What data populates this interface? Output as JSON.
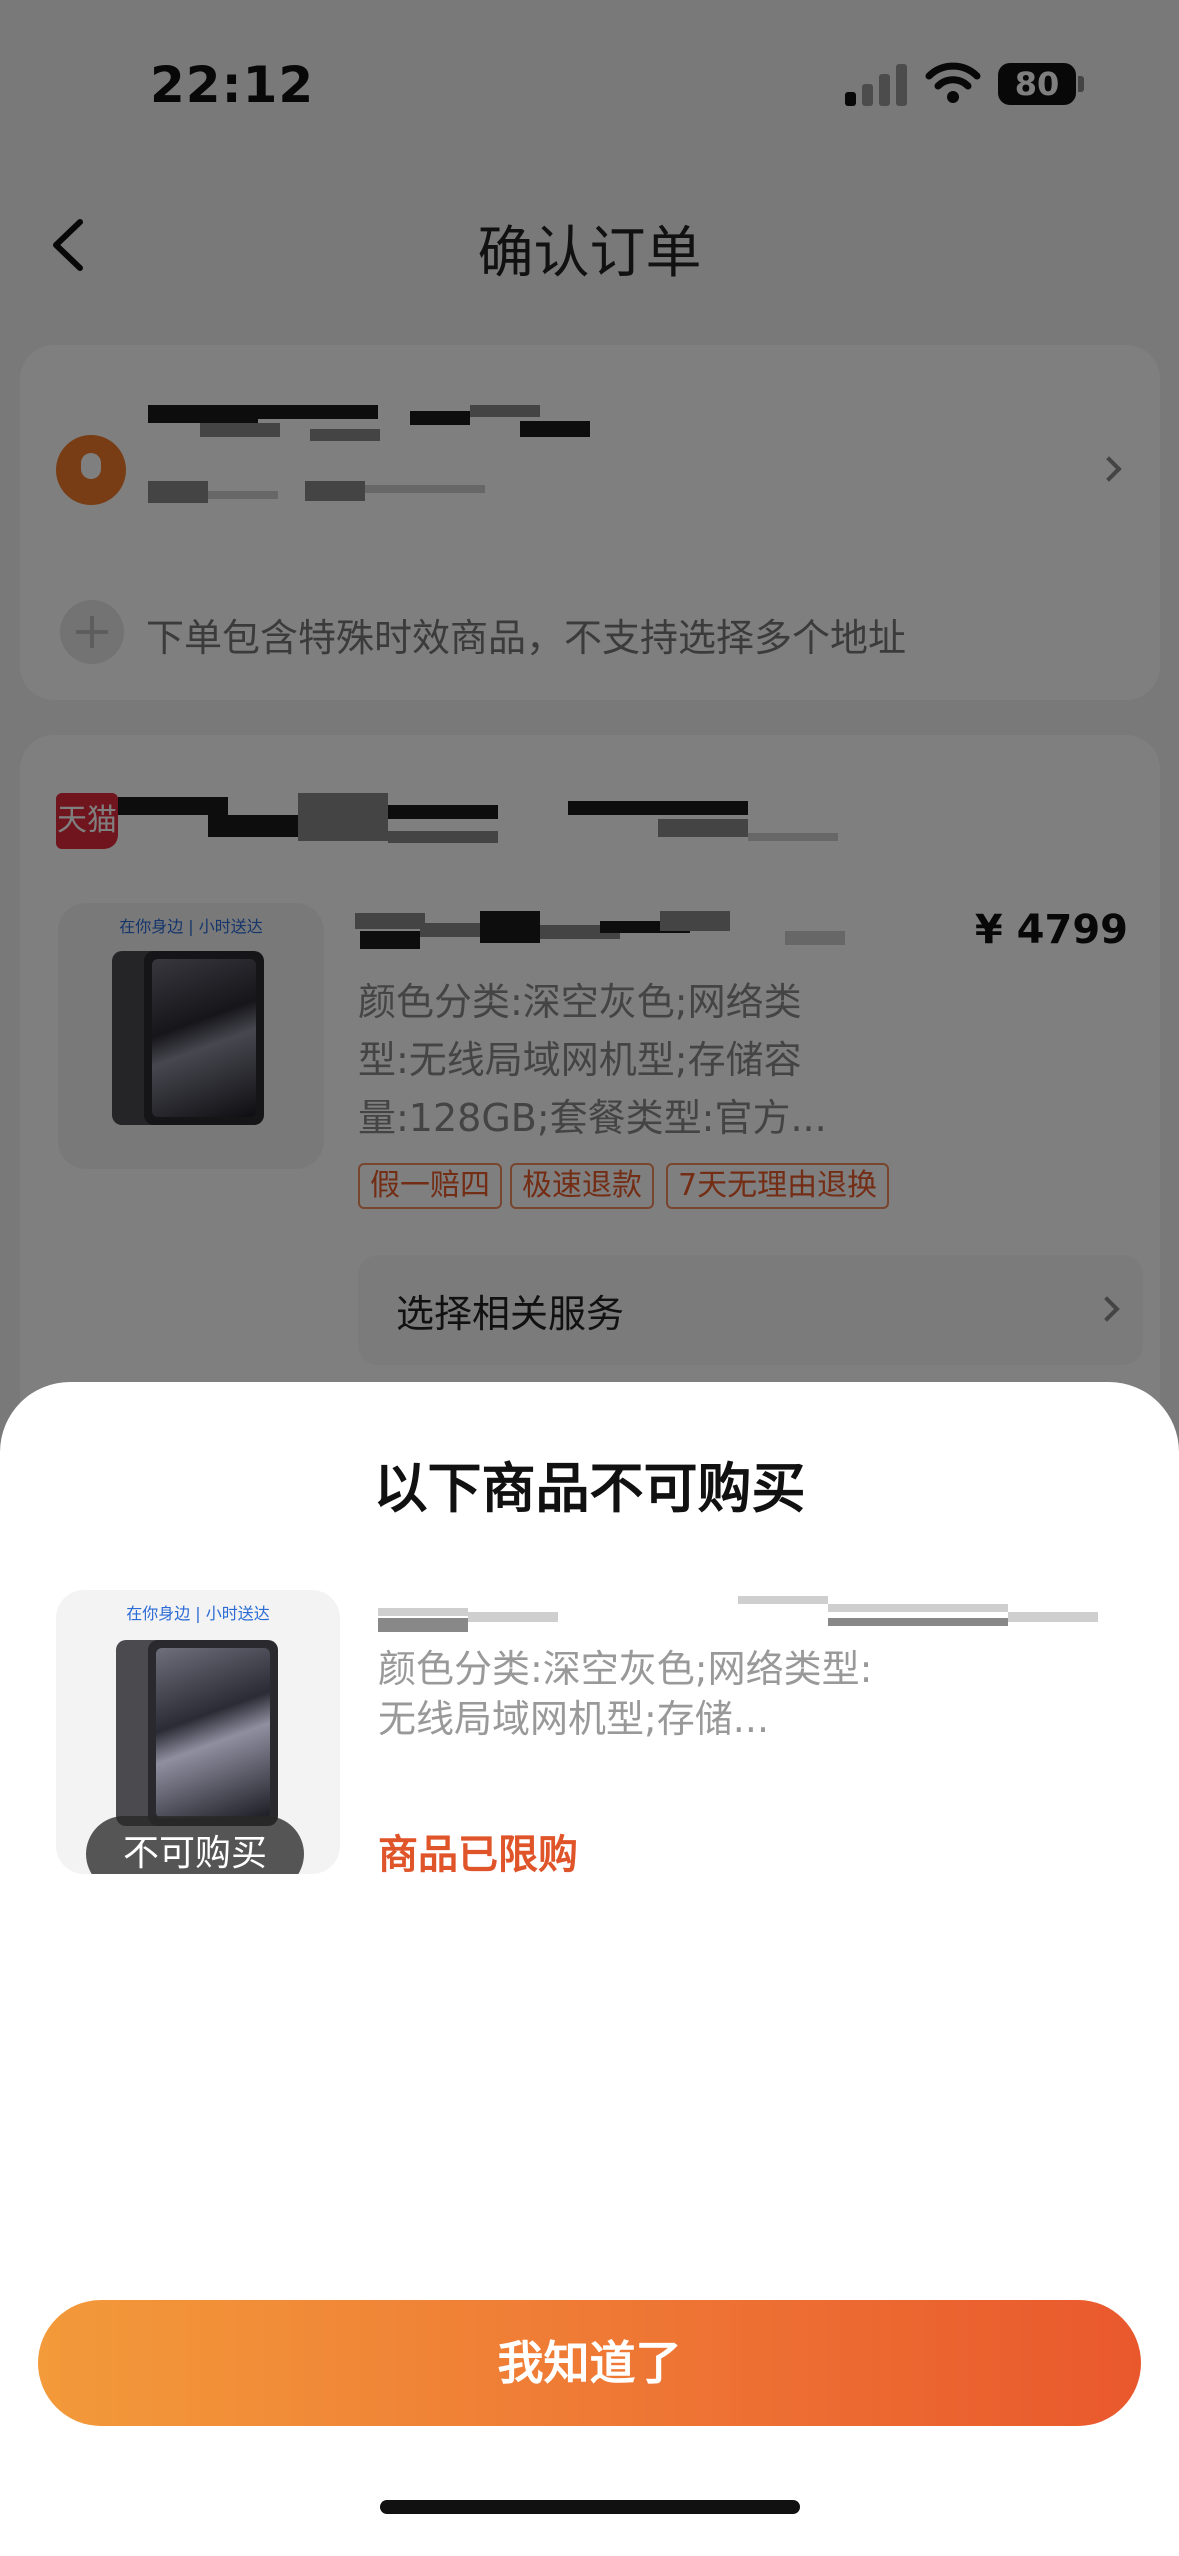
{
  "status_bar": {
    "time": "22:12",
    "battery": "80"
  },
  "nav": {
    "title": "确认订单"
  },
  "address_card": {
    "note": "下单包含特殊时效商品，不支持选择多个地址"
  },
  "order_card": {
    "store_badge": "天猫",
    "thumb_tags": "在你身边 | 小时送达",
    "price": "¥ 4799",
    "spec_lines": [
      "颜色分类:深空灰色;网络类",
      "型:无线局域网机型;存储容",
      "量:128GB;套餐类型:官方..."
    ],
    "tags": [
      "假一赔四",
      "极速退款",
      "7天无理由退换"
    ],
    "service_label": "选择相关服务"
  },
  "sheet": {
    "title": "以下商品不可购买",
    "thumb_tags": "在你身边 | 小时送达",
    "overlay_label": "不可购买",
    "spec_lines": [
      "颜色分类:深空灰色;网络类型:",
      "无线局域网机型;存储..."
    ],
    "limit_text": "商品已限购",
    "confirm_label": "我知道了"
  },
  "colors": {
    "accent_start": "#f39a3a",
    "accent_end": "#e9582d",
    "warning_text": "#e0542a",
    "tag_border": "#f08a5c"
  }
}
